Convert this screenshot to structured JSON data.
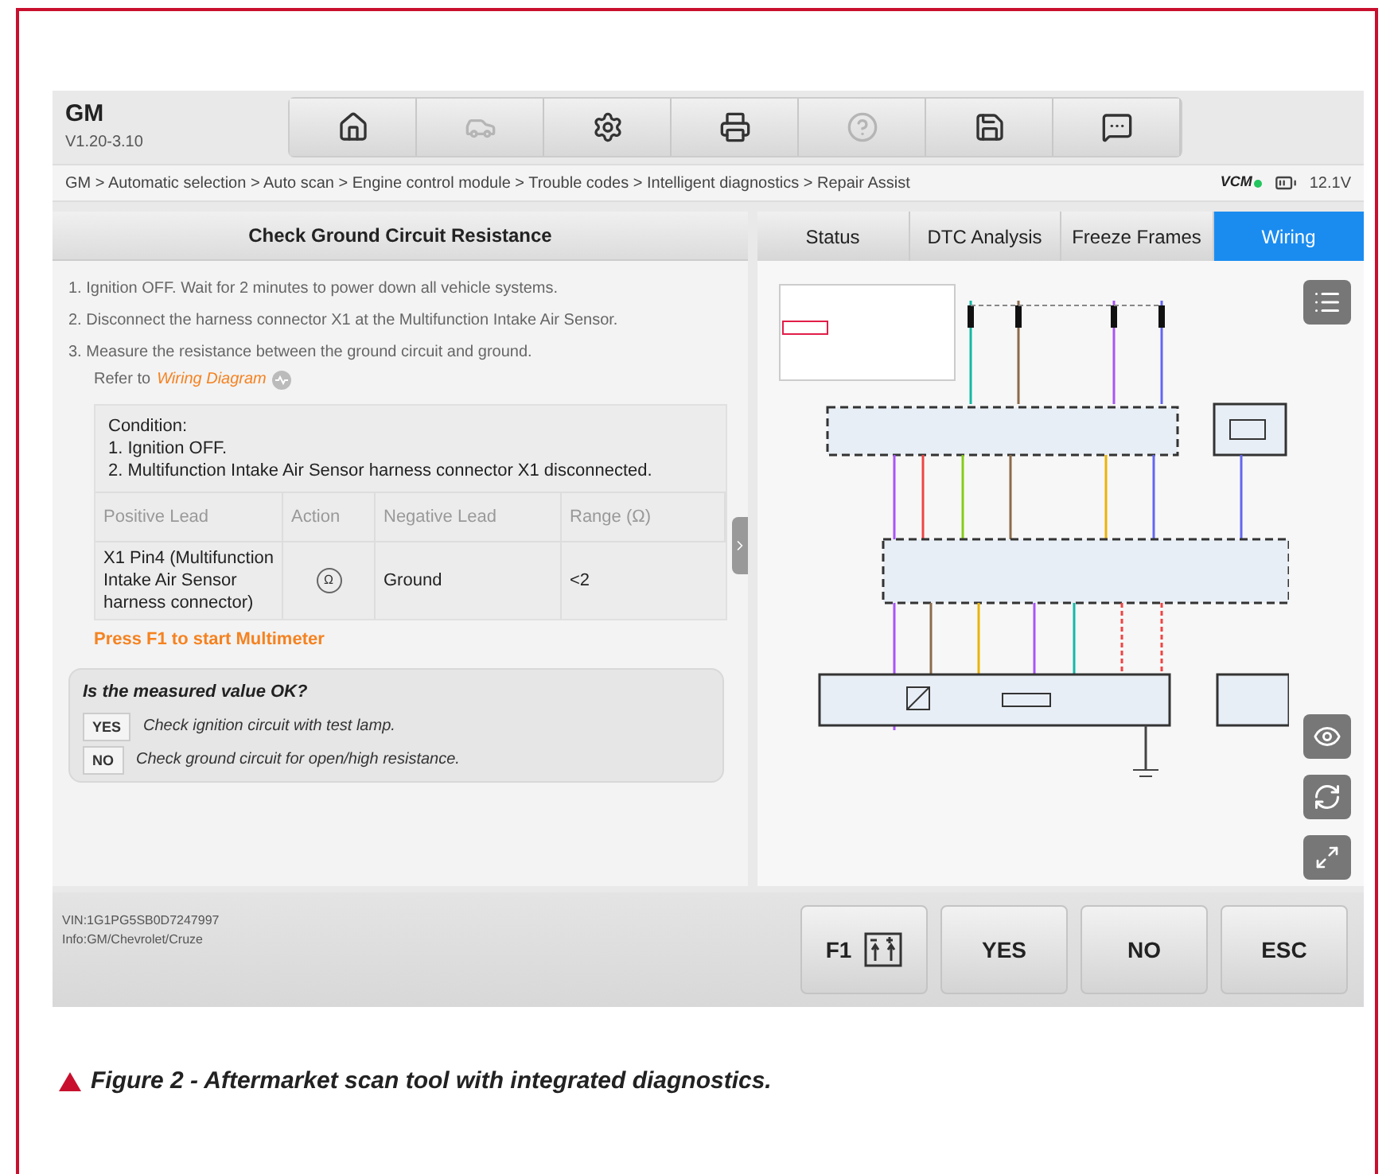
{
  "header": {
    "title": "GM",
    "version": "V1.20-3.10"
  },
  "toolbar": [
    {
      "kind": "home",
      "disabled": false
    },
    {
      "kind": "vehicle",
      "disabled": true
    },
    {
      "kind": "settings",
      "disabled": false
    },
    {
      "kind": "print",
      "disabled": false
    },
    {
      "kind": "help",
      "disabled": true
    },
    {
      "kind": "save",
      "disabled": false
    },
    {
      "kind": "message",
      "disabled": false
    }
  ],
  "breadcrumb": "GM > Automatic selection > Auto scan > Engine control module > Trouble codes > Intelligent diagnostics > Repair Assist",
  "status": {
    "vcm": "VCM",
    "vcm_connected": true,
    "voltage": "12.1V"
  },
  "procedure": {
    "title": "Check Ground Circuit Resistance",
    "steps": [
      {
        "number": "1.",
        "text": "Ignition OFF. Wait for 2 minutes to power down all vehicle systems."
      },
      {
        "number": "2.",
        "text": "Disconnect the harness connector X1 at the Multifunction Intake Air Sensor."
      },
      {
        "number": "3.",
        "text": "Measure the resistance between the ground circuit and ground."
      }
    ],
    "refer": {
      "text": "Refer to",
      "link": "Wiring Diagram"
    },
    "condition": [
      "Condition:",
      "1. Ignition OFF.",
      "2. Multifunction Intake Air Sensor harness connector X1 disconnected."
    ],
    "table": {
      "columns": [
        "Positive Lead",
        "Action",
        "Negative Lead",
        "Range (Ω)"
      ],
      "rows": [
        {
          "positive": "X1 Pin4 (Multifunction Intake Air Sensor harness connector)",
          "action": "Ω",
          "negative": "Ground",
          "range": "<2"
        }
      ]
    },
    "hint": "Press F1 to start Multimeter",
    "question": "Is the measured value OK?",
    "answers": [
      {
        "label": "YES",
        "text": "Check ignition circuit with test lamp."
      },
      {
        "label": "NO",
        "text": "Check ground circuit for open/high resistance."
      }
    ]
  },
  "tabs": [
    {
      "label": "Status",
      "selected": false
    },
    {
      "label": "DTC Analysis",
      "selected": false
    },
    {
      "label": "Freeze Frames",
      "selected": false
    },
    {
      "label": "Wiring",
      "selected": true
    }
  ],
  "footer": {
    "vin": "VIN:1G1PG5SB0D7247997",
    "info": "Info:GM/Chevrolet/Cruze"
  },
  "buttons": [
    {
      "label": "F1",
      "kind": "multimeter"
    },
    {
      "label": "YES",
      "kind": "plain"
    },
    {
      "label": "NO",
      "kind": "plain"
    },
    {
      "label": "ESC",
      "kind": "plain"
    }
  ],
  "caption": "Figure 2 - Aftermarket scan tool with integrated diagnostics."
}
